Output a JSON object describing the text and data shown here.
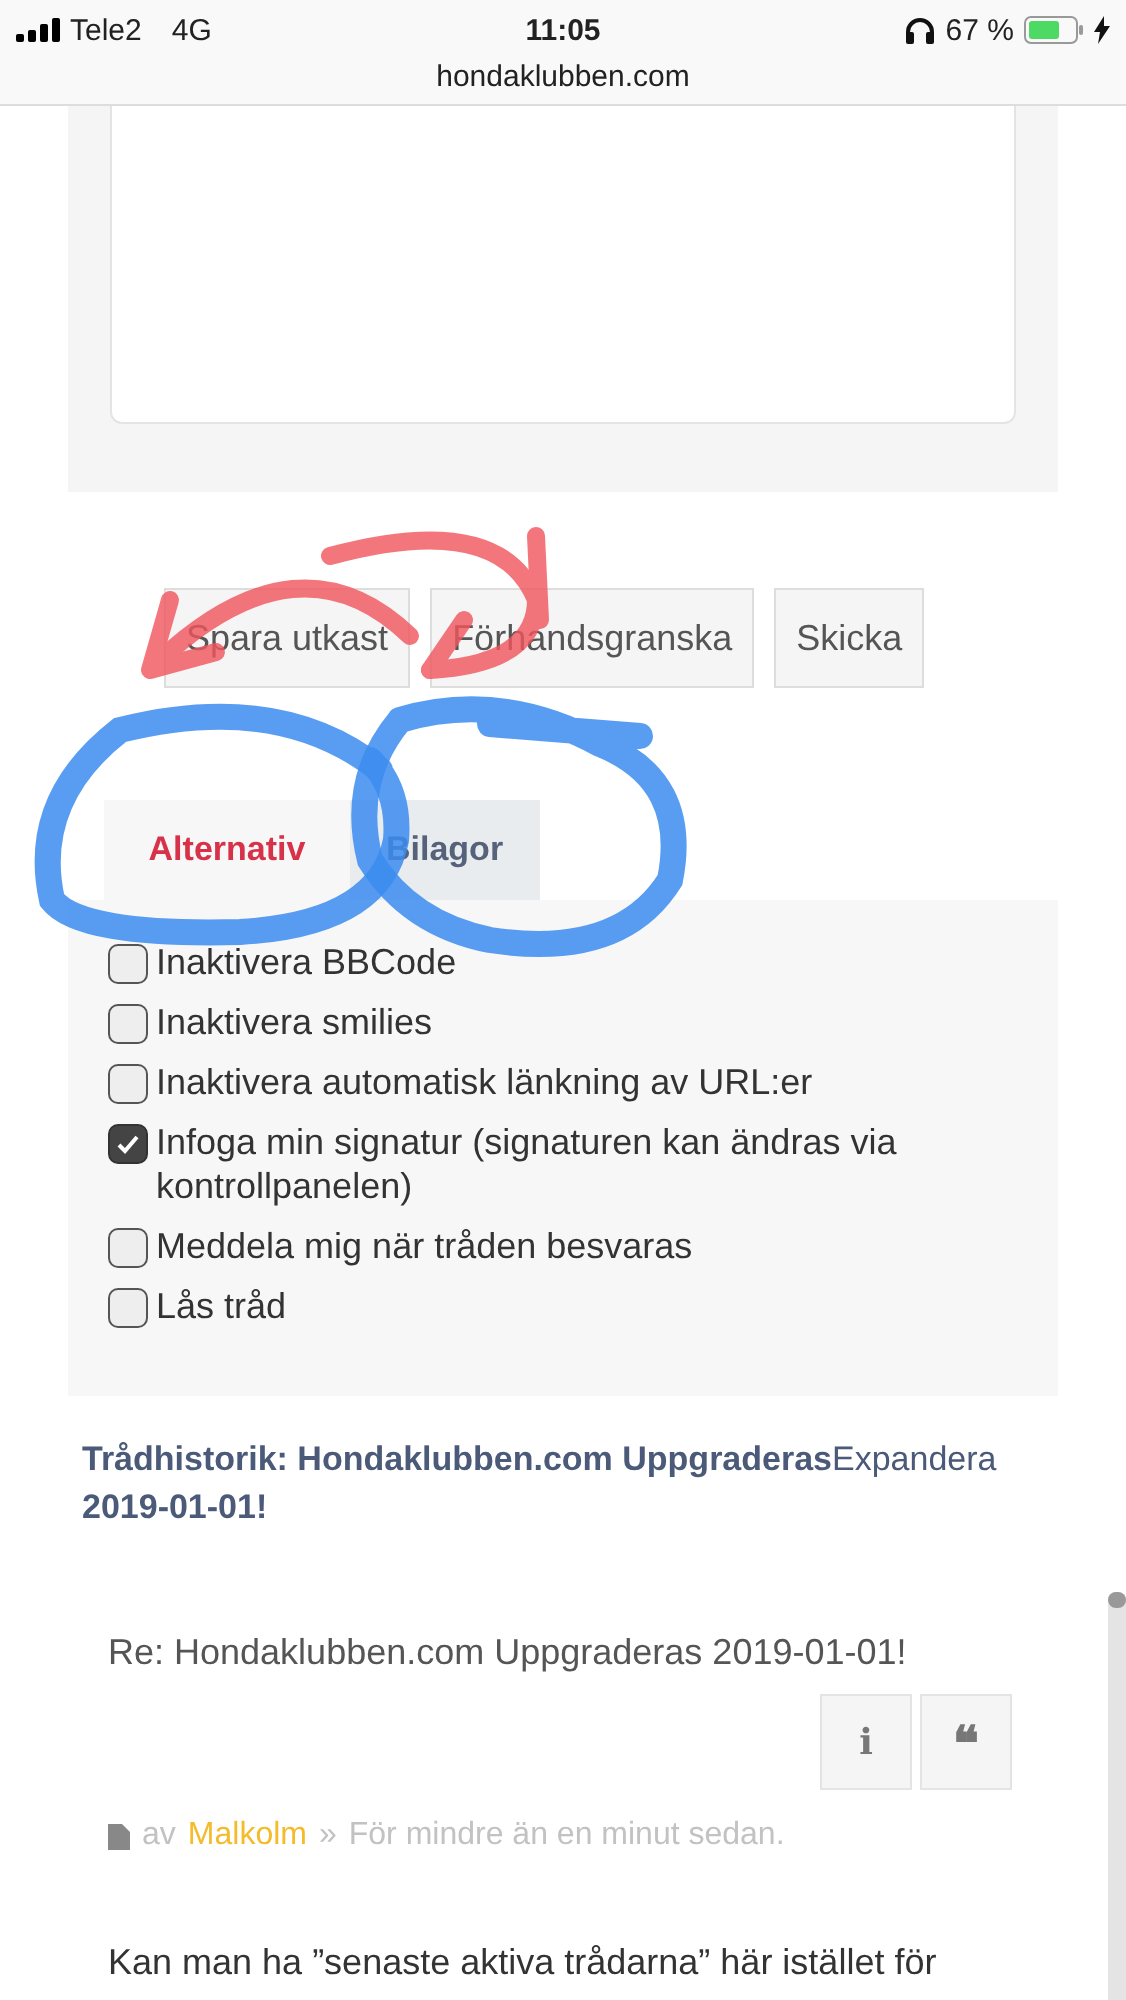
{
  "status_bar": {
    "carrier": "Tele2",
    "network": "4G",
    "time": "11:05",
    "battery": "67 %"
  },
  "address_bar": {
    "url": "hondaklubben.com"
  },
  "editor": {
    "kind": "textarea"
  },
  "buttons": [
    "Spara utkast",
    "Förhandsgranska",
    "Skicka"
  ],
  "tabs": [
    {
      "label": "Alternativ",
      "selected": true
    },
    {
      "label": "Bilagor",
      "selected": false
    }
  ],
  "options": [
    {
      "label": "Inaktivera BBCode",
      "checked": false
    },
    {
      "label": "Inaktivera smilies",
      "checked": false
    },
    {
      "label": "Inaktivera automatisk länkning av URL:er",
      "checked": false
    },
    {
      "label": "Infoga min signatur (signaturen kan ändras via kontrollpanelen)",
      "checked": true
    },
    {
      "label": "Meddela mig när tråden besvaras",
      "checked": false
    },
    {
      "label": "Lås tråd",
      "checked": false
    }
  ],
  "history": {
    "title": "Trådhistorik: Hondaklubben.com Uppgraderas",
    "expand": "Expandera",
    "title_end": "2019-01-01!"
  },
  "post": {
    "title": "Re: Hondaklubben.com Uppgraderas 2019-01-01!",
    "info_button": "i",
    "quote_button": "❝",
    "by": "av",
    "author": "Malkolm",
    "separator": "»",
    "time": "För mindre än en minut sedan.",
    "body": "Kan man ha ”senaste aktiva trådarna” här istället för"
  }
}
